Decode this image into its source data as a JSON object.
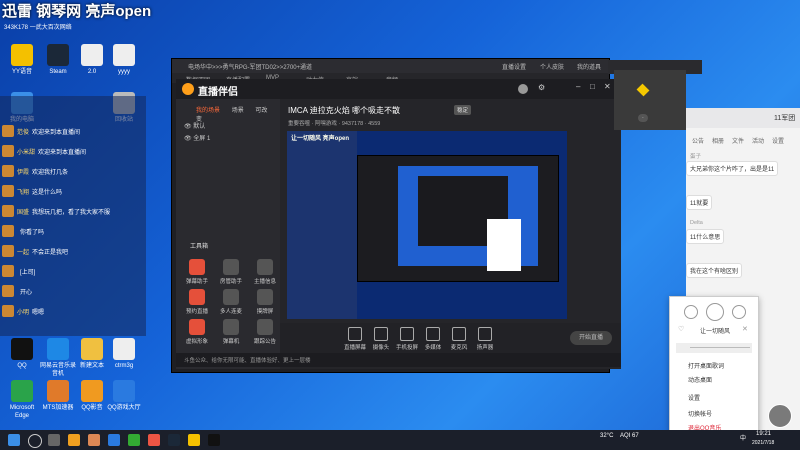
{
  "overlay": {
    "title": "迅雷 钢琴网 亮声open",
    "subtitle": "343K178 一武大百次网络"
  },
  "desktop_icons": [
    {
      "label": "YY语音",
      "color": "#f4c000"
    },
    {
      "label": "Steam",
      "color": "#1b2838"
    },
    {
      "label": "2.0",
      "color": "#eee"
    },
    {
      "label": "yyyy",
      "color": "#eee"
    },
    {
      "label": "我的电脑",
      "color": "#3b8fe8"
    },
    {
      "label": "回收站",
      "color": "#bbb"
    },
    {
      "label": "QQ",
      "color": "#111"
    },
    {
      "label": "网易云音乐录音机",
      "color": "#1e88e5"
    },
    {
      "label": "新建文本",
      "color": "#f0c040"
    },
    {
      "label": "ctrm3g",
      "color": "#eee"
    },
    {
      "label": "Microsoft Edge",
      "color": "#2aa34a"
    },
    {
      "label": "MTS加速器",
      "color": "#e07a2a"
    },
    {
      "label": "QQ影音",
      "color": "#f09a20"
    },
    {
      "label": "QQ游戏大厅",
      "color": "#2a7ae0"
    }
  ],
  "chat": {
    "rows": [
      {
        "name": "范俊",
        "text": "欢迎来到本直播间"
      },
      {
        "name": "小米甜",
        "text": "欢迎来到本直播间"
      },
      {
        "name": "伊霞",
        "text": "欢迎我打几条"
      },
      {
        "name": "飞翔",
        "text": "这是什么吗"
      },
      {
        "name": "国盛",
        "text": "我想玩几把，看了我大家不服"
      },
      {
        "name": "",
        "text": "你看了吗"
      },
      {
        "name": "一起",
        "text": "不会正是我吧"
      },
      {
        "name": "",
        "text": "[上司]"
      },
      {
        "name": "",
        "text": "开心"
      },
      {
        "name": "小明",
        "text": "嗯嗯"
      }
    ]
  },
  "obs": {
    "title": "电场华中>>>勇气RPG-军团TD02>>2700+通道",
    "menu": [
      "数据双团",
      "直播配置",
      "MVP",
      "动力值",
      "高端",
      "音频"
    ],
    "buttons": [
      "直播设置",
      "个人皮肤",
      "我的道具"
    ]
  },
  "live": {
    "app_name": "直播伴侣",
    "tabs": [
      "我的场景",
      "场景",
      "可改变"
    ],
    "scenes": [
      "默认",
      "全屏 1"
    ],
    "stream_title": "IMCA 迪拉克火焰 哪个吸走不散",
    "tag": "稳定",
    "meta": [
      "重要吞噬",
      "阿嘿游戏"
    ],
    "viewers": "9437178",
    "likes": "4559",
    "tools_title": "工具箱",
    "tools": [
      "弹幕助手",
      "房管助手",
      "主播信息",
      "预约直播",
      "多人连麦",
      "摸牌屏",
      "虚拟形象",
      "弹幕机",
      "跟踪公告"
    ],
    "bottom_buttons": [
      "直播屏幕",
      "摄像头",
      "手机投屏",
      "多媒体",
      "麦克风",
      "扬声器"
    ],
    "start_button": "开始直播",
    "status": "斗鱼公众、给你无限可能、直播体验好、更上一层楼",
    "preview_text": "让一切随风 亮声open"
  },
  "qq": {
    "title": "11军团",
    "tabs": [
      "公告",
      "相册",
      "文件",
      "活动",
      "设置"
    ],
    "messages": [
      {
        "name": "蛋子",
        "text": "大兄弟你这个片咋了，出是是11"
      },
      {
        "name": "",
        "text": "11就要"
      },
      {
        "name": "Delta",
        "text": "11什么意思"
      },
      {
        "name": "",
        "text": "我在这个有啥区别"
      }
    ]
  },
  "music_menu": {
    "song": "让一切随风",
    "items": [
      "打开桌面歌词",
      "动态桌面",
      "设置",
      "切换帐号",
      "退出QQ音乐"
    ]
  },
  "taskbar": {
    "temp": "32°C",
    "aqi": "AQI 67",
    "ime": "中",
    "time": "19:21",
    "date": "2021/7/18"
  }
}
